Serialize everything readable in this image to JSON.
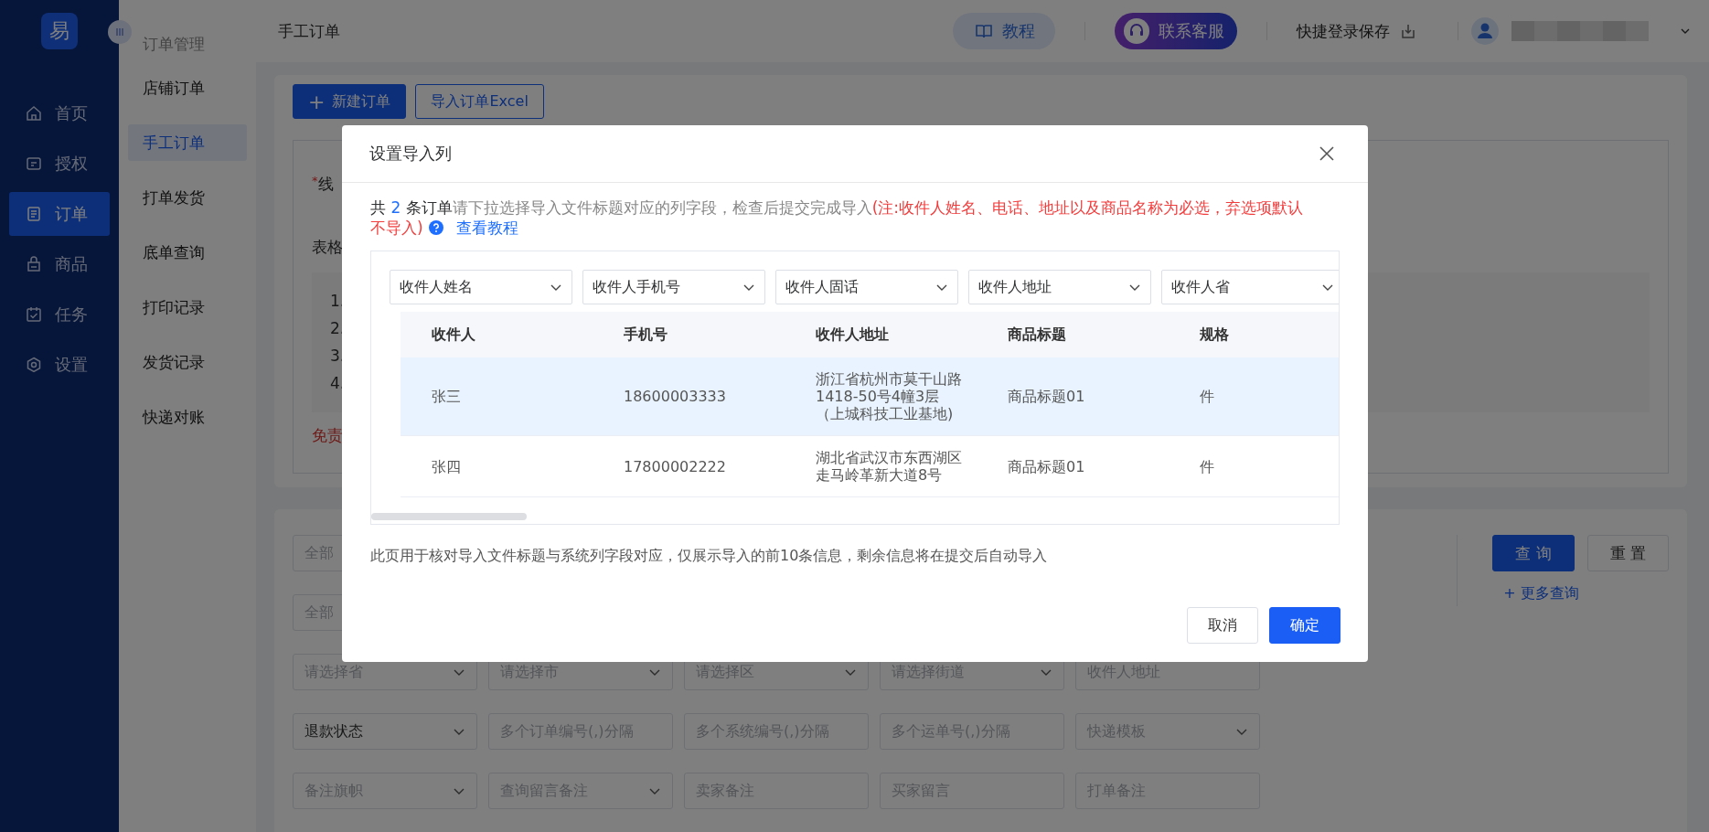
{
  "sidebar": {
    "logo": "易",
    "items": [
      {
        "label": "首页",
        "selected": false
      },
      {
        "label": "授权",
        "selected": false
      },
      {
        "label": "订单",
        "selected": true
      },
      {
        "label": "商品",
        "selected": false
      },
      {
        "label": "任务",
        "selected": false
      },
      {
        "label": "设置",
        "selected": false
      }
    ]
  },
  "subnav": {
    "title": "订单管理",
    "items": [
      {
        "label": "店铺订单",
        "selected": false
      },
      {
        "label": "手工订单",
        "selected": true
      },
      {
        "label": "打单发货",
        "selected": false
      },
      {
        "label": "底单查询",
        "selected": false
      },
      {
        "label": "打印记录",
        "selected": false
      },
      {
        "label": "发货记录",
        "selected": false
      },
      {
        "label": "快递对账",
        "selected": false
      }
    ]
  },
  "topbar": {
    "title": "手工订单",
    "tutorial": "教程",
    "support": "联系客服",
    "quick_save": "快捷登录保存"
  },
  "page": {
    "buttons": [
      {
        "label": "新建订单",
        "kind": "primary",
        "icon": "+"
      },
      {
        "label": "导入订单Excel",
        "kind": "outline"
      }
    ],
    "notice": {
      "required_mark": "*",
      "title": "线",
      "table_label": "表格",
      "steps": [
        "1.",
        "2.",
        "3.",
        "4."
      ],
      "disclaimer": "免责"
    }
  },
  "filters": {
    "rows": [
      {
        "fields": [
          {
            "kind": "input",
            "placeholder": "全部"
          }
        ]
      },
      {
        "fields": [
          {
            "kind": "input",
            "placeholder": "全部"
          }
        ]
      },
      {
        "fields": [
          {
            "kind": "select",
            "placeholder": "请选择省"
          },
          {
            "kind": "select",
            "placeholder": "请选择市"
          },
          {
            "kind": "select",
            "placeholder": "请选择区"
          },
          {
            "kind": "select",
            "placeholder": "请选择街道"
          },
          {
            "kind": "input",
            "placeholder": "收件人地址"
          }
        ]
      },
      {
        "fields": [
          {
            "kind": "select",
            "value": "退款状态"
          },
          {
            "kind": "input",
            "placeholder": "多个订单编号(,)分隔"
          },
          {
            "kind": "input",
            "placeholder": "多个系统编号(,)分隔"
          },
          {
            "kind": "input",
            "placeholder": "多个运单号(,)分隔"
          },
          {
            "kind": "select",
            "placeholder": "快递模板"
          }
        ]
      },
      {
        "fields": [
          {
            "kind": "select",
            "placeholder": "备注旗帜"
          },
          {
            "kind": "select",
            "placeholder": "查询留言备注"
          },
          {
            "kind": "input",
            "placeholder": "卖家备注"
          },
          {
            "kind": "input",
            "placeholder": "买家留言"
          },
          {
            "kind": "input",
            "placeholder": "打单备注"
          }
        ]
      }
    ],
    "query": "查 询",
    "reset": "重 置",
    "more": "+ 更多查询"
  },
  "dialog": {
    "title": "设置导入列",
    "count_prefix": "共",
    "count": "2",
    "count_suffix": "条订单",
    "hint": "请下拉选择导入文件标题对应的列字段，检查后提交完成导入",
    "warning": [
      "(注:收件人姓名、电话、地址以及商品名称为必选，弃选项默认",
      "不导入)"
    ],
    "link": "查看教程",
    "mappings": [
      "收件人姓名",
      "收件人手机号",
      "收件人固话",
      "收件人地址",
      "收件人省"
    ],
    "columns": [
      "收件人",
      "手机号",
      "收件人地址",
      "商品标题",
      "规格"
    ],
    "rows": [
      {
        "selected": true,
        "cells": [
          "张三",
          "18600003333",
          "浙江省杭州市莫干山路1418-50号4幢3层（上城科技工业基地)",
          "商品标题01",
          "件"
        ]
      },
      {
        "selected": false,
        "cells": [
          "张四",
          "17800002222",
          "湖北省武汉市东西湖区走马岭革新大道8号",
          "商品标题01",
          "件"
        ]
      }
    ],
    "note": "此页用于核对导入文件标题与系统列字段对应，仅展示导入的前10条信息，剩余信息将在提交后自动导入",
    "cancel": "取消",
    "confirm": "确定"
  }
}
